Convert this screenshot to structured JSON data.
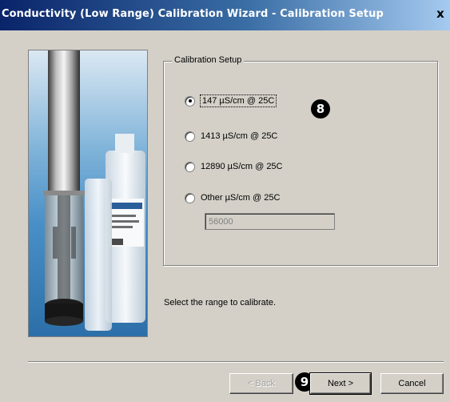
{
  "window": {
    "title": "Conductivity (Low Range) Calibration Wizard - Calibration Setup",
    "close_label": "x"
  },
  "group": {
    "label": "Calibration Setup",
    "options": [
      {
        "label": "147 µS/cm @ 25C",
        "selected": true
      },
      {
        "label": "1413 µS/cm @ 25C",
        "selected": false
      },
      {
        "label": "12890 µS/cm @ 25C",
        "selected": false
      },
      {
        "label": "Other µS/cm @ 25C",
        "selected": false
      }
    ],
    "other_value": "56000"
  },
  "instruction": "Select the range to calibrate.",
  "buttons": {
    "back": "< Back",
    "next": "Next >",
    "cancel": "Cancel"
  },
  "markers": {
    "m8": "8",
    "m9": "9"
  }
}
